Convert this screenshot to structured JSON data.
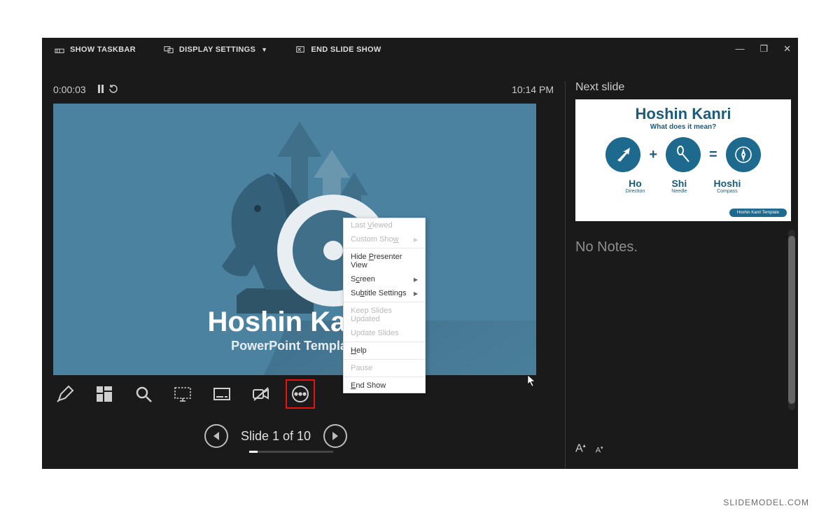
{
  "topbar": {
    "show_taskbar": "SHOW TASKBAR",
    "display_settings": "DISPLAY SETTINGS",
    "end_slide_show": "END SLIDE SHOW"
  },
  "window": {
    "minimize": "—",
    "restore": "❐",
    "close": "✕"
  },
  "timer": {
    "elapsed": "0:00:03",
    "clock": "10:14 PM"
  },
  "current_slide": {
    "title": "Hoshin Kanri",
    "subtitle": "PowerPoint Template"
  },
  "context_menu": {
    "items": [
      {
        "label": "Last Viewed",
        "ukey": "V",
        "enabled": false,
        "arrow": false
      },
      {
        "label": "Custom Show",
        "ukey": "w",
        "enabled": false,
        "arrow": true
      },
      {
        "sep": true
      },
      {
        "label": "Hide Presenter View",
        "ukey": "P",
        "enabled": true,
        "arrow": false
      },
      {
        "label": "Screen",
        "ukey": "c",
        "enabled": true,
        "arrow": true
      },
      {
        "label": "Subtitle Settings",
        "ukey": "b",
        "enabled": true,
        "arrow": true
      },
      {
        "sep": true
      },
      {
        "label": "Keep Slides Updated",
        "ukey": "",
        "enabled": false,
        "arrow": false
      },
      {
        "label": "Update Slides",
        "ukey": "",
        "enabled": false,
        "arrow": false
      },
      {
        "sep": true
      },
      {
        "label": "Help",
        "ukey": "H",
        "enabled": true,
        "arrow": false
      },
      {
        "sep": true
      },
      {
        "label": "Pause",
        "ukey": "",
        "enabled": false,
        "arrow": false
      },
      {
        "sep": true
      },
      {
        "label": "End Show",
        "ukey": "E",
        "enabled": true,
        "arrow": false
      }
    ]
  },
  "nav": {
    "label": "Slide 1 of 10"
  },
  "next": {
    "heading": "Next slide",
    "title": "Hoshin Kanri",
    "subtitle": "What does it mean?",
    "items": [
      {
        "big": "Ho",
        "small": "Direction"
      },
      {
        "big": "Shi",
        "small": "Needle"
      },
      {
        "big": "Hoshi",
        "small": "Compass"
      }
    ],
    "badge": "Hoshin Kanri Template"
  },
  "notes": {
    "empty_text": "No Notes."
  },
  "watermark": "SLIDEMODEL.COM"
}
